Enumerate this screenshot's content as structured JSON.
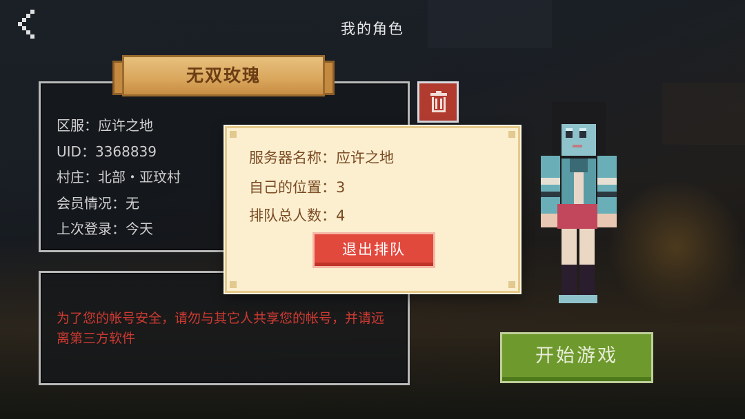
{
  "header": {
    "title": "我的角色",
    "back_icon": "chevron-left-icon"
  },
  "character": {
    "name": "无双玫瑰",
    "info": [
      {
        "label": "区服：",
        "value": "应许之地"
      },
      {
        "label": "UID：",
        "value": "3368839"
      },
      {
        "label": "村庄：",
        "value": "北部・亚玟村"
      },
      {
        "label": "会员情况：",
        "value": "无"
      },
      {
        "label": "上次登录：",
        "value": "今天"
      }
    ],
    "delete_icon": "trash-icon"
  },
  "warning": {
    "text": "为了您的帐号安全，请勿与其它人共享您的帐号，并请远离第三方软件"
  },
  "queue_dialog": {
    "server_label": "服务器名称：",
    "server_value": "应许之地",
    "position_label": "自己的位置：",
    "position_value": "3",
    "total_label": "排队总人数：",
    "total_value": "4",
    "exit_button": "退出排队"
  },
  "actions": {
    "start_game": "开始游戏"
  },
  "colors": {
    "warning_text": "#d03a32",
    "start_button": "#6e9a2d",
    "exit_button": "#e2493d",
    "delete_button": "#b23b30",
    "dialog_bg": "#fbefd0",
    "banner": "#d9a65c"
  }
}
